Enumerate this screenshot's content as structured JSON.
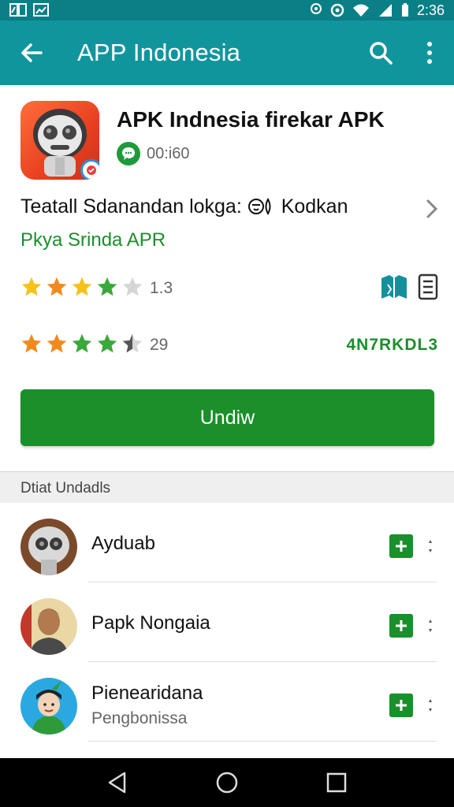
{
  "status_bar": {
    "time": "2:36"
  },
  "app_bar": {
    "title": "APP Indonesia"
  },
  "app": {
    "title": "APK Indnesia firekar APK",
    "size": "00:i60",
    "description_line1": "Teatall Sdanandan lokga:",
    "description_extra": "Kodkan",
    "developer": "Pkya Srinda APR",
    "rating1": {
      "value": 4,
      "text": "1.3"
    },
    "rating2": {
      "value": 4.5,
      "text": "29"
    },
    "code": "4N7RKDL3",
    "download_label": "Undiw"
  },
  "section": {
    "title": "Dtiat Undadls"
  },
  "list": [
    {
      "name": "Ayduab",
      "sub": ""
    },
    {
      "name": "Papk Nongaia",
      "sub": ""
    },
    {
      "name": "Pienearidana",
      "sub": "Pengbonissa"
    }
  ],
  "colors": {
    "primary": "#11959d",
    "status": "#0a7f86",
    "accent_green": "#1a8f2a",
    "star_gold": "#f6c21a",
    "star_orange": "#f08a1e",
    "star_green": "#3aa83a"
  },
  "icons": [
    "back-arrow-icon",
    "search-icon",
    "more-vert-icon",
    "chat-icon",
    "chevron-right-icon",
    "book-icon",
    "document-icon",
    "plus-icon",
    "nav-back-icon",
    "nav-home-icon",
    "nav-recents-icon"
  ]
}
